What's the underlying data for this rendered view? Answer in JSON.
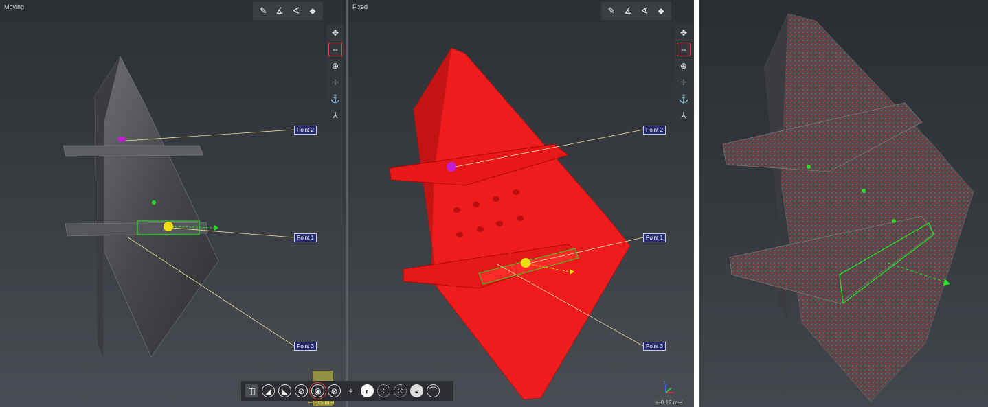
{
  "viewports": {
    "moving": {
      "title": "Moving",
      "scale": "0.15 m",
      "points": [
        "Point 2",
        "Point 1",
        "Point 3"
      ]
    },
    "fixed": {
      "title": "Fixed",
      "scale": "0.12 m",
      "points": [
        "Point 2",
        "Point 1",
        "Point 3"
      ]
    }
  },
  "top_toolbar_icons": [
    "ruler-icon",
    "angle-icon",
    "angle-vertical-icon",
    "tag-icon"
  ],
  "side_toolbar_icons": [
    "pan-icon",
    "fit-icon",
    "zoom-icon",
    "center-icon",
    "anchor-icon",
    "axes-icon"
  ],
  "bottom_toolbar_icons": [
    "split-view-icon",
    "shade-left-icon",
    "shade-right-icon",
    "clip-icon",
    "point-target-icon",
    "clear-icon",
    "crosshair-icon",
    "checker-icon",
    "points-icon",
    "scatter-icon",
    "sphere-icon",
    "curve-icon"
  ],
  "axis_label": "Z",
  "colors": {
    "fixed_mesh": "#ee1c1c",
    "selection": "#22e022",
    "point1": "#f0e010",
    "point2": "#c020d0"
  }
}
